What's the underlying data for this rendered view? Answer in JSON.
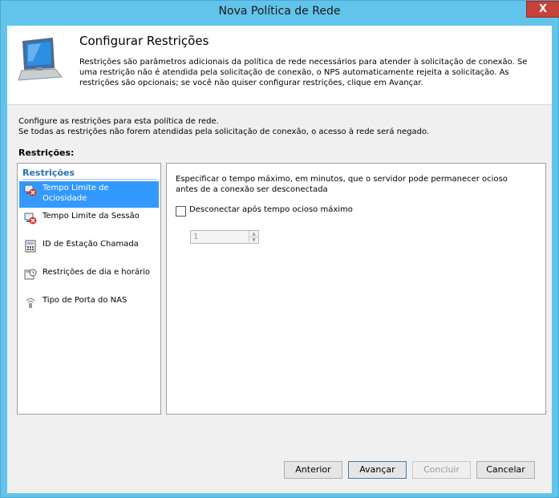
{
  "window": {
    "title": "Nova Política de Rede",
    "close_label": "X"
  },
  "header": {
    "title": "Configurar Restrições",
    "description": "Restrições são parâmetros adicionais da política de rede necessários para atender à solicitação de conexão. Se uma restrição não é atendida pela solicitação de conexão, o NPS automaticamente rejeita a solicitação. As restrições são opcionais; se você não quiser configurar restrições, clique em Avançar."
  },
  "intro": {
    "line1": "Configure as restrições para esta política de rede.",
    "line2": "Se todas as restrições não forem atendidas pela solicitação de conexão, o acesso à rede será negado."
  },
  "restrictions_label": "Restrições:",
  "nav": {
    "group_header": "Restrições",
    "items": [
      {
        "label": "Tempo Limite de Ociosidade",
        "icon": "idle-timeout-icon",
        "selected": true
      },
      {
        "label": "Tempo Limite da Sessão",
        "icon": "session-timeout-icon",
        "selected": false
      },
      {
        "label": "ID de Estação Chamada",
        "icon": "station-id-icon",
        "selected": false
      },
      {
        "label": "Restrições de dia e horário",
        "icon": "day-time-icon",
        "selected": false
      },
      {
        "label": "Tipo de Porta do NAS",
        "icon": "nas-port-icon",
        "selected": false
      }
    ]
  },
  "panel": {
    "description": "Especificar o tempo máximo, em minutos, que o servidor pode permanecer ocioso antes de a conexão ser desconectada",
    "checkbox_label": "Desconectar após tempo ocioso máximo",
    "checkbox_checked": false,
    "spinner_value": "1"
  },
  "buttons": {
    "back": "Anterior",
    "next": "Avançar",
    "finish": "Concluir",
    "cancel": "Cancelar"
  }
}
